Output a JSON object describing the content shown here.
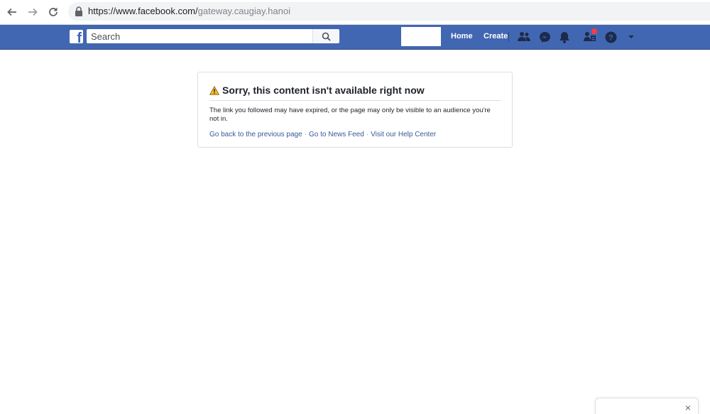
{
  "browser": {
    "url_host": "https://www.facebook.com/",
    "url_path": "gateway.caugiay.hanoi"
  },
  "header": {
    "search_placeholder": "Search",
    "home_label": "Home",
    "create_label": "Create",
    "brand_color": "#4267b2"
  },
  "error": {
    "title": "Sorry, this content isn't available right now",
    "message": "The link you followed may have expired, or the page may only be visible to an audience you're not in.",
    "link_back": "Go back to the previous page",
    "link_feed": "Go to News Feed",
    "link_help": "Visit our Help Center",
    "separator": "·"
  },
  "chat": {
    "close_glyph": "×"
  }
}
